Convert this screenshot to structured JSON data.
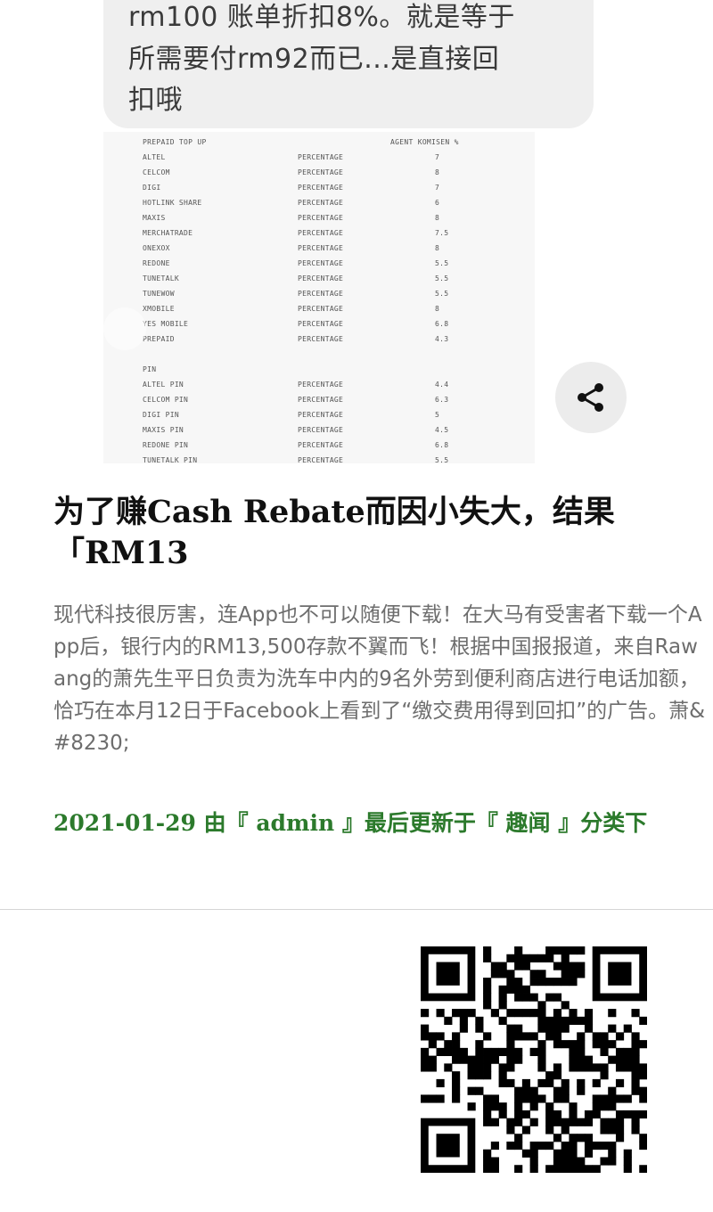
{
  "hero": {
    "bubble_lines": [
      "rm100 账单折扣8%。就是等于",
      "所需要付rm92而已...是直接回",
      "扣哦"
    ],
    "table_header": [
      "PREPAID TOP UP",
      "AGENT KOMISEN %"
    ],
    "table_rows": [
      [
        "ALTEL",
        "PERCENTAGE",
        "7"
      ],
      [
        "CELCOM",
        "PERCENTAGE",
        "8"
      ],
      [
        "DIGI",
        "PERCENTAGE",
        "7"
      ],
      [
        "HOTLINK SHARE",
        "PERCENTAGE",
        "6"
      ],
      [
        "MAXIS",
        "PERCENTAGE",
        "8"
      ],
      [
        "MERCHATRADE",
        "PERCENTAGE",
        "7.5"
      ],
      [
        "ONEXOX",
        "PERCENTAGE",
        "8"
      ],
      [
        "REDONE",
        "PERCENTAGE",
        "5.5"
      ],
      [
        "TUNETALK",
        "PERCENTAGE",
        "5.5"
      ],
      [
        "TUNEWOW",
        "PERCENTAGE",
        "5.5"
      ],
      [
        "XMOBILE",
        "PERCENTAGE",
        "8"
      ],
      [
        "YES MOBILE",
        "PERCENTAGE",
        "6.8"
      ],
      [
        "PREPAID",
        "PERCENTAGE",
        "4.3"
      ],
      [
        "",
        "",
        ""
      ],
      [
        "PIN",
        "",
        ""
      ],
      [
        "ALTEL PIN",
        "PERCENTAGE",
        "4.4"
      ],
      [
        "CELCOM PIN",
        "PERCENTAGE",
        "6.3"
      ],
      [
        "DIGI PIN",
        "PERCENTAGE",
        "5"
      ],
      [
        "MAXIS PIN",
        "PERCENTAGE",
        "4.5"
      ],
      [
        "REDONE PIN",
        "PERCENTAGE",
        "6.8"
      ],
      [
        "TUNETALK PIN",
        "PERCENTAGE",
        "5.5"
      ]
    ],
    "share_icon": "share-icon"
  },
  "article": {
    "title": "为了赚Cash Rebate而因小失大，结果「RM13",
    "excerpt": "现代科技很厉害，连App也不可以随便下载！在大马有受害者下载一个App后，银行内的RM13,500存款不翼而飞！根据中国报报道，来自Rawang的萧先生平日负责为洗车中内的9名外劳到便利商店进行电话加额，恰巧在本月12日于Facebook上看到了“缴交费用得到回扣”的广告。萧&#8230;",
    "meta": "2021-01-29 由『 admin 』最后更新于『 趣闻 』分类下"
  },
  "colors": {
    "meta_green": "#2c7a2c",
    "excerpt_gray": "#6d6d6d"
  },
  "qr_icon": "qr-code"
}
